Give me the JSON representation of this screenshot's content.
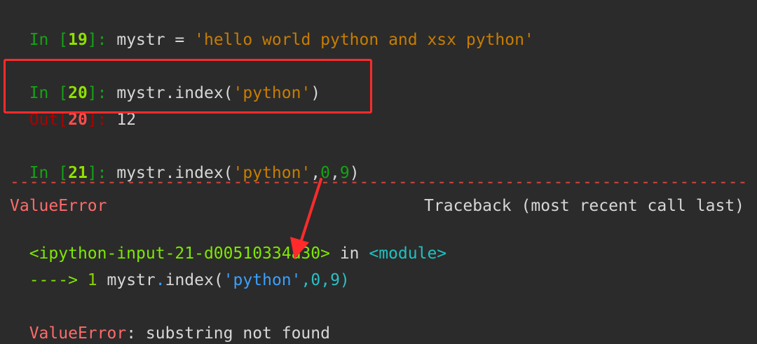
{
  "cells": [
    {
      "in_prefix": "In [",
      "in_number": "19",
      "in_suffix": "]: ",
      "code_parts": [
        "mystr = ",
        "'hello world python and xsx python'"
      ]
    },
    {
      "in_prefix": "In [",
      "in_number": "20",
      "in_suffix": "]: ",
      "code_parts": [
        "mystr.index(",
        "'python'",
        ")"
      ],
      "out_prefix": "Out[",
      "out_number": "20",
      "out_suffix": "]: ",
      "out_value": "12"
    },
    {
      "in_prefix": "In [",
      "in_number": "21",
      "in_suffix": "]: ",
      "code_parts": [
        "mystr.index(",
        "'python'",
        ",",
        "0",
        ",",
        "9",
        ")"
      ]
    }
  ],
  "traceback": {
    "separator": "---------------------------------------------------------------------------------------------------",
    "error_type": "ValueError",
    "header_right": "Traceback (most recent call last)",
    "file_ref": "<ipython-input-21-d00510334a30>",
    "in_word": " in ",
    "module_ref": "<module>",
    "arrow": "---->",
    "line_number": " 1 ",
    "code_parts": [
      "mystr",
      ".",
      "index(",
      "'python'",
      ",",
      "0",
      ",",
      "9",
      ")"
    ],
    "final_error_type": "ValueError",
    "final_message": ": substring not found"
  },
  "colors": {
    "highlight_box": "#ff2b2b",
    "annotation_arrow": "#ff2b2b"
  }
}
